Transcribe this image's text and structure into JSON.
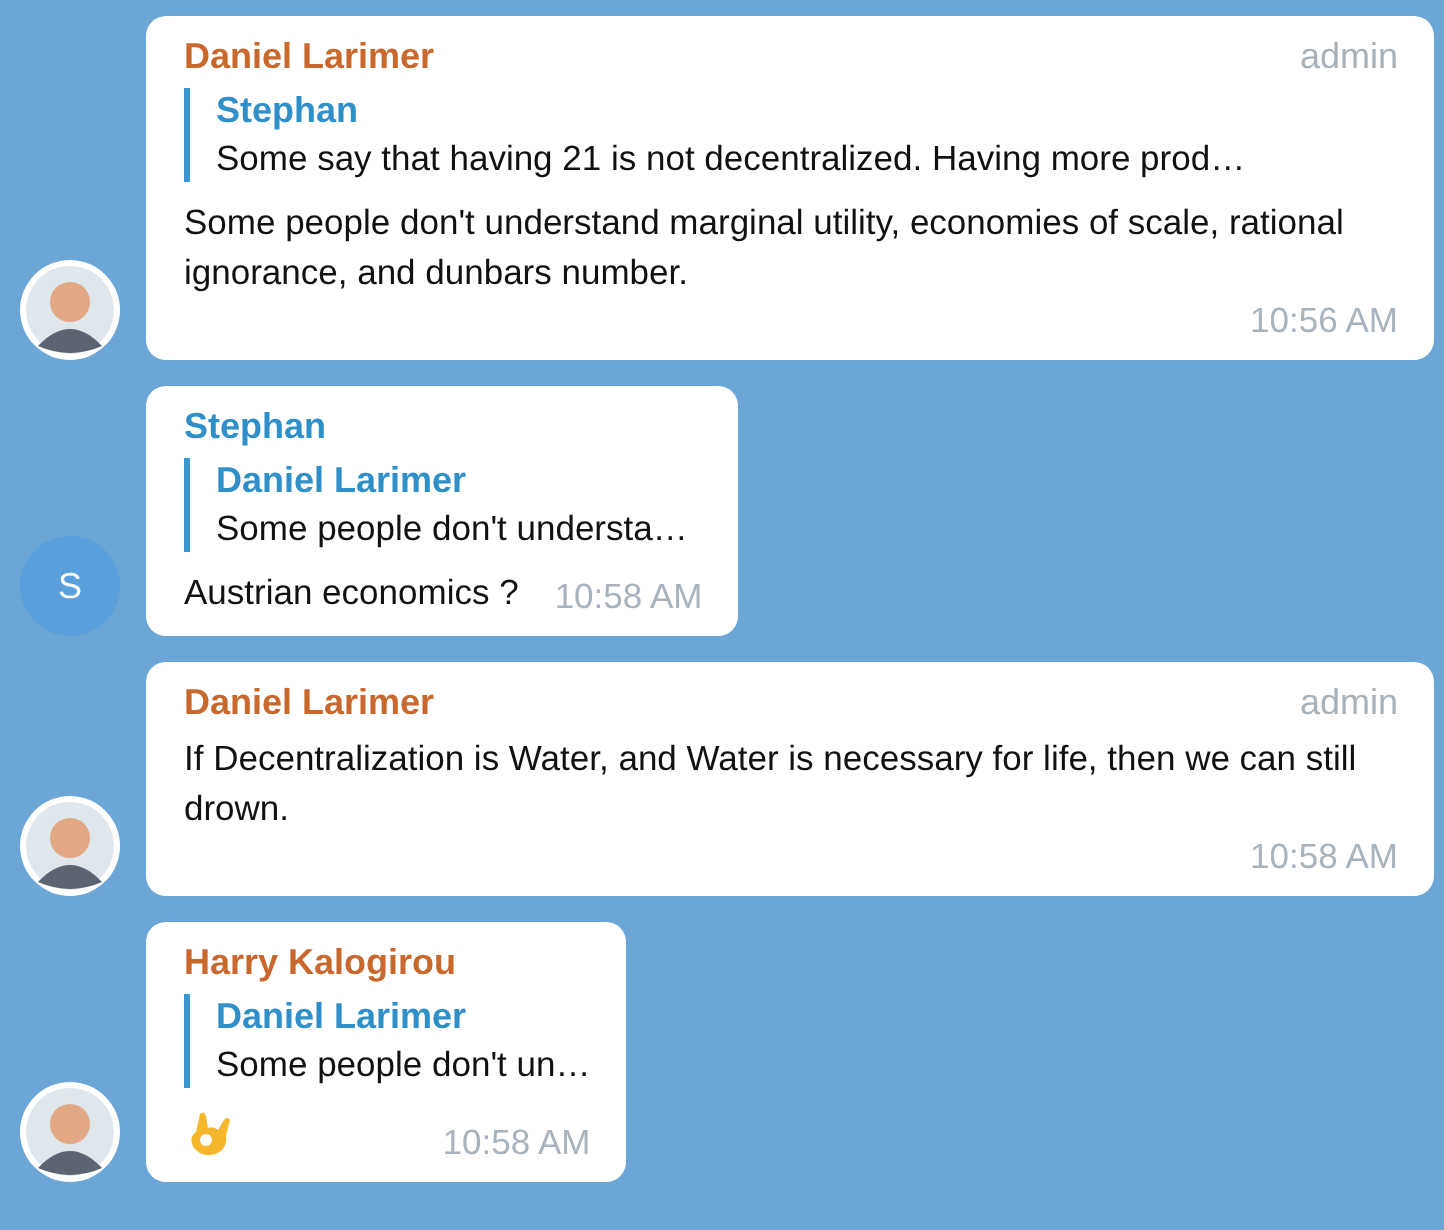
{
  "messages": [
    {
      "kind": "text",
      "author": "Daniel Larimer",
      "color": "#c8682c",
      "badge": "admin",
      "reply": {
        "author": "Stephan",
        "text": "Some say that having 21 is not decentralized. Having more prod…"
      },
      "text": "Some people don't understand marginal utility, economies of scale, rational ignorance, and dunbars number.",
      "time": "10:56 AM"
    },
    {
      "kind": "text",
      "author": "Stephan",
      "color": "#2f8fc9",
      "avatar": {
        "kind": "letter",
        "letter": "S",
        "color": "#5aa0dc"
      },
      "reply": {
        "author": "Daniel Larimer",
        "text": "Some people don't understa…"
      },
      "text": "Austrian economics ?",
      "time": "10:58 AM"
    },
    {
      "kind": "text",
      "author": "Daniel Larimer",
      "color": "#c8682c",
      "badge": "admin",
      "text": "If Decentralization is Water, and Water is necessary for life, then we can still drown.",
      "time": "10:58 AM"
    },
    {
      "kind": "sticker",
      "author": "Harry Kalogirou",
      "color": "#c8682c",
      "reply": {
        "author": "Daniel Larimer",
        "text": "Some people don't un…"
      },
      "time": "10:58 AM"
    }
  ]
}
